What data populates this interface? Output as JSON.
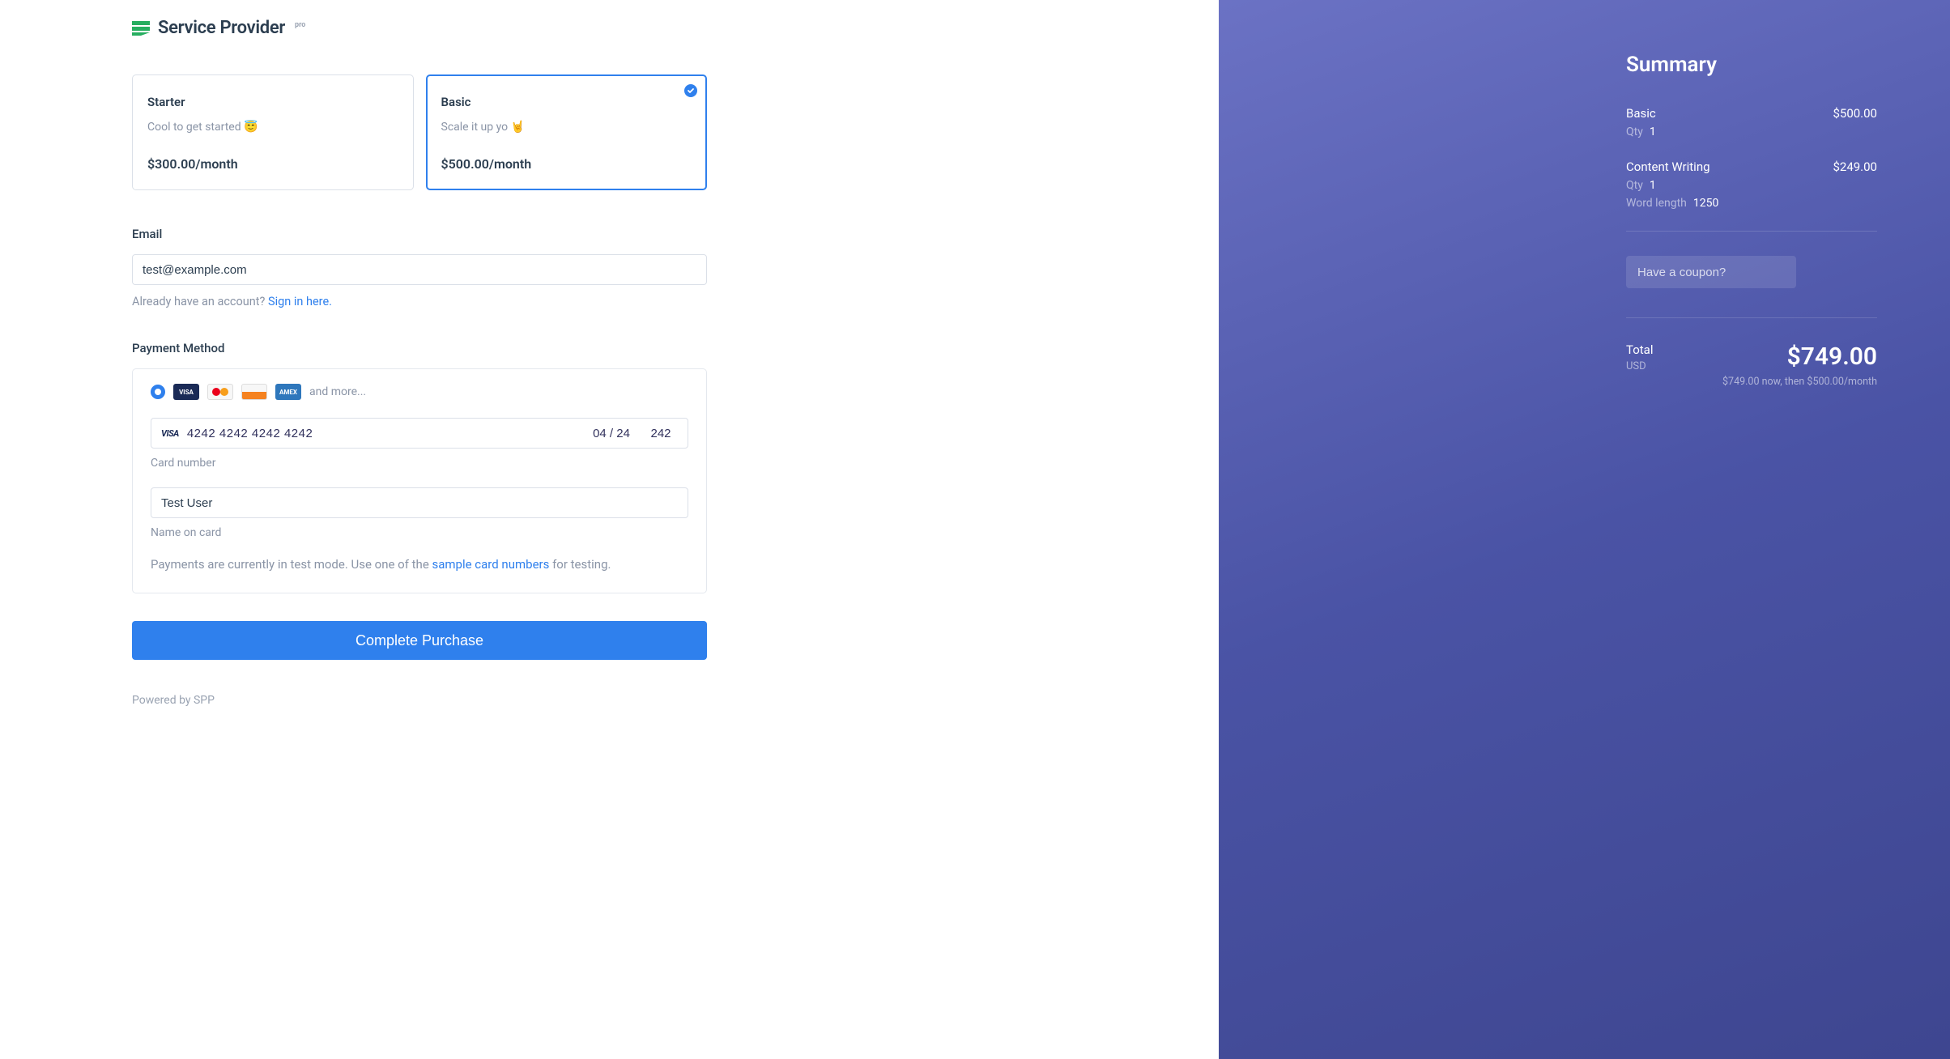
{
  "brand": {
    "name": "Service Provider",
    "badge": "pro"
  },
  "plans": [
    {
      "name": "Starter",
      "desc": "Cool to get started 😇",
      "price": "$300.00/month",
      "selected": false
    },
    {
      "name": "Basic",
      "desc": "Scale it up yo 🤘",
      "price": "$500.00/month",
      "selected": true
    }
  ],
  "email": {
    "label": "Email",
    "value": "test@example.com",
    "helper_prefix": "Already have an account? ",
    "helper_link": "Sign in here."
  },
  "payment": {
    "label": "Payment Method",
    "more_text": "and more...",
    "card_number": "4242 4242 4242 4242",
    "card_exp": "04 / 24",
    "card_cvc": "242",
    "card_number_label": "Card number",
    "name_on_card": "Test User",
    "name_label": "Name on card",
    "test_note_prefix": "Payments are currently in test mode. Use one of the ",
    "test_note_link": "sample card numbers",
    "test_note_suffix": " for testing."
  },
  "submit_label": "Complete Purchase",
  "powered": "Powered by SPP",
  "summary": {
    "title": "Summary",
    "items": [
      {
        "name": "Basic",
        "price": "$500.00",
        "qty_label": "Qty",
        "qty": "1"
      },
      {
        "name": "Content Writing",
        "price": "$249.00",
        "qty_label": "Qty",
        "qty": "1",
        "extra_label": "Word length",
        "extra_value": "1250"
      }
    ],
    "coupon_placeholder": "Have a coupon?",
    "total_label": "Total",
    "total_currency": "USD",
    "total_amount": "$749.00",
    "total_note": "$749.00 now, then $500.00/month"
  }
}
